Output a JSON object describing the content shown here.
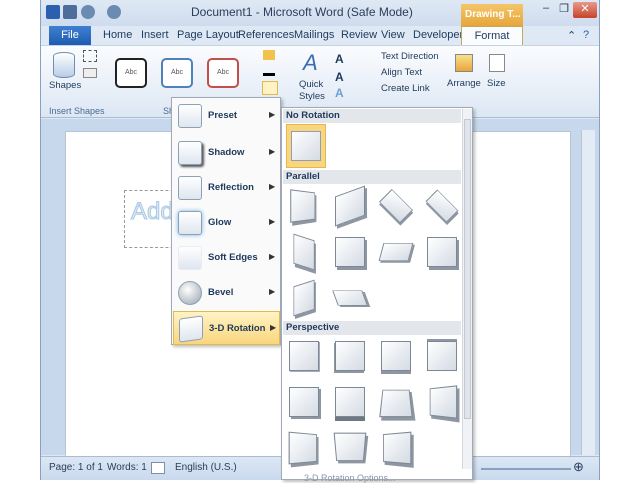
{
  "window": {
    "title": "Document1 - Microsoft Word (Safe Mode)",
    "contextual_tab": "Drawing T..."
  },
  "tabs": [
    "File",
    "Home",
    "Insert",
    "Page Layout",
    "References",
    "Mailings",
    "Review",
    "View",
    "Developer",
    "Format"
  ],
  "ribbon": {
    "shapes_label": "Shapes",
    "insert_shapes_group": "Insert Shapes",
    "style_sample": "Abc",
    "quick_styles_label": "Quick\nStyles",
    "text_direction": "Text Direction",
    "align_text": "Align Text",
    "create_link": "Create Link",
    "arrange_label": "Arrange",
    "size_label": "Size",
    "shape_styles_group_partial": "Sh"
  },
  "effects_menu": [
    {
      "label": "Preset"
    },
    {
      "label": "Shadow"
    },
    {
      "label": "Reflection"
    },
    {
      "label": "Glow"
    },
    {
      "label": "Soft Edges"
    },
    {
      "label": "Bevel"
    },
    {
      "label": "3-D Rotation",
      "highlighted": true
    }
  ],
  "rotation_gallery": {
    "sections": [
      "No Rotation",
      "Parallel",
      "Perspective"
    ],
    "footer": "3-D Rotation Options..."
  },
  "document": {
    "textbox_text": "Add"
  },
  "status_bar": {
    "page": "Page: 1 of 1",
    "words": "Words: 1",
    "language": "English (U.S.)"
  },
  "colors": {
    "accent": "#1f5cb1",
    "highlight": "#f9d67d",
    "contextual": "#e7a63a"
  }
}
